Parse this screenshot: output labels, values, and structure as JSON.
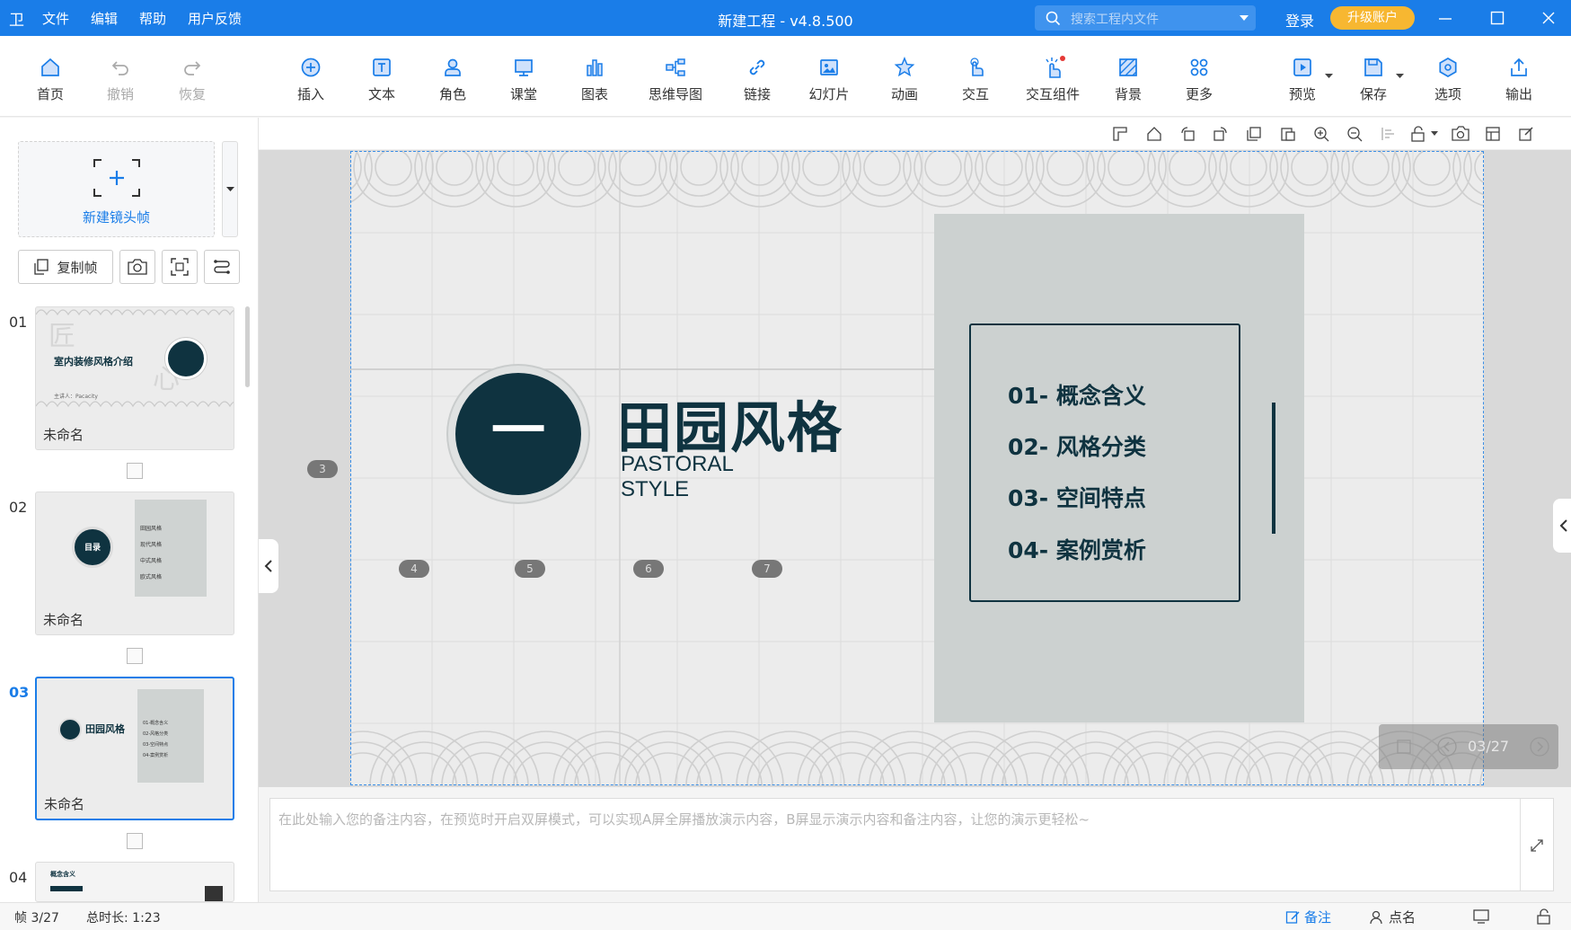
{
  "window": {
    "menu": [
      "文件",
      "编辑",
      "帮助",
      "用户反馈"
    ],
    "title": "新建工程 - v4.8.500",
    "search_placeholder": "搜索工程内文件",
    "login": "登录",
    "upgrade": "升级账户",
    "accent_color": "#1a7de8"
  },
  "toolbar": {
    "items": [
      {
        "label": "首页",
        "icon": "home-icon"
      },
      {
        "label": "撤销",
        "icon": "undo-icon"
      },
      {
        "label": "恢复",
        "icon": "redo-icon"
      },
      {
        "label": "插入",
        "icon": "insert-icon"
      },
      {
        "label": "文本",
        "icon": "text-icon"
      },
      {
        "label": "角色",
        "icon": "character-icon"
      },
      {
        "label": "课堂",
        "icon": "classroom-icon"
      },
      {
        "label": "图表",
        "icon": "chart-icon"
      },
      {
        "label": "思维导图",
        "icon": "mindmap-icon"
      },
      {
        "label": "链接",
        "icon": "link-icon"
      },
      {
        "label": "幻灯片",
        "icon": "slides-icon"
      },
      {
        "label": "动画",
        "icon": "animation-icon"
      },
      {
        "label": "交互",
        "icon": "interaction-icon"
      },
      {
        "label": "交互组件",
        "icon": "widget-icon"
      },
      {
        "label": "背景",
        "icon": "background-icon"
      },
      {
        "label": "更多",
        "icon": "more-icon"
      },
      {
        "label": "预览",
        "icon": "preview-icon"
      },
      {
        "label": "保存",
        "icon": "save-icon"
      },
      {
        "label": "选项",
        "icon": "options-icon"
      },
      {
        "label": "输出",
        "icon": "export-icon"
      }
    ]
  },
  "sidebar": {
    "new_frame": "新建镜头帧",
    "copy_frame": "复制帧",
    "slides": [
      {
        "num": "01",
        "name": "未命名",
        "thumb_title": "室内装修风格介绍",
        "thumb_small": "主讲人：Pacacity"
      },
      {
        "num": "02",
        "name": "未命名",
        "thumb_title": "目录",
        "thumb_items": [
          "田园风格",
          "现代风格",
          "中式风格",
          "欧式风格"
        ]
      },
      {
        "num": "03",
        "name": "未命名",
        "thumb_title": "田园风格",
        "thumb_items": [
          "01-概念含义",
          "02-风格分类",
          "03-空间特点",
          "04-案例赏析"
        ]
      },
      {
        "num": "04",
        "name": "",
        "thumb_title": "概念含义"
      }
    ],
    "active_index": 2
  },
  "slide": {
    "badge_number": "一",
    "title": "田园风格",
    "subtitle_line1": "PASTORAL",
    "subtitle_line2": "STYLE",
    "toc": [
      "01- 概念含义",
      "02- 风格分类",
      "03- 空间特点",
      "04- 案例赏析"
    ],
    "frame_markers": [
      "3",
      "4",
      "5",
      "6",
      "7"
    ],
    "page_indicator": "03/27",
    "dark_color": "#0f3340",
    "panel_color": "#ccd1d0"
  },
  "notes": {
    "placeholder": "在此处输入您的备注内容，在预览时开启双屏模式，可以实现A屏全屏播放演示内容，B屏显示演示内容和备注内容，让您的演示更轻松~"
  },
  "status": {
    "frame": "帧 3/27",
    "duration": "总时长: 1:23",
    "notes_btn": "备注",
    "rollcall_btn": "点名"
  }
}
